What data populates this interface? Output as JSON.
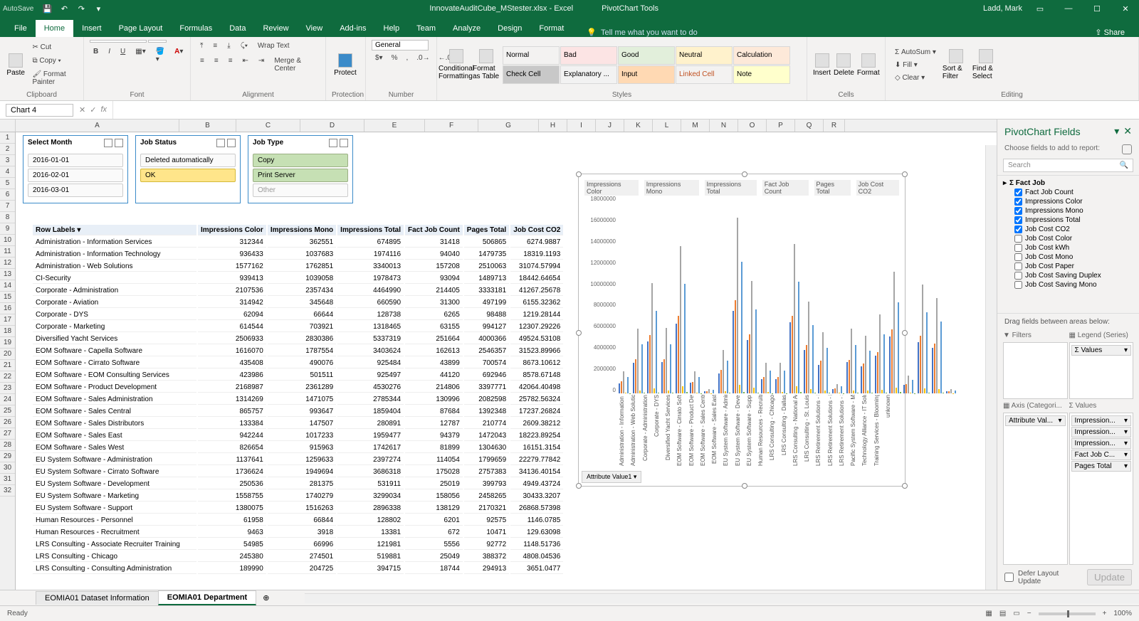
{
  "titlebar": {
    "autosave": "AutoSave",
    "filename": "InnovateAuditCube_MStester.xlsx - Excel",
    "tool_context": "PivotChart Tools",
    "user": "Ladd, Mark",
    "share": "Share"
  },
  "tabs": [
    "File",
    "Home",
    "Insert",
    "Page Layout",
    "Formulas",
    "Data",
    "Review",
    "View",
    "Add-ins",
    "Help",
    "Team",
    "Analyze",
    "Design",
    "Format"
  ],
  "active_tab": "Home",
  "tell_me": "Tell me what you want to do",
  "ribbon": {
    "clipboard": {
      "paste": "Paste",
      "cut": "Cut",
      "copy": "Copy",
      "fp": "Format Painter",
      "label": "Clipboard"
    },
    "font_label": "Font",
    "alignment": {
      "wrap": "Wrap Text",
      "merge": "Merge & Center",
      "label": "Alignment"
    },
    "protection": {
      "protect": "Protect",
      "label": "Protection"
    },
    "number": {
      "general": "General",
      "label": "Number"
    },
    "cond": "Conditional Formatting",
    "fat": "Format as Table",
    "styles_label": "Styles",
    "styles": [
      "Normal",
      "Bad",
      "Good",
      "Neutral",
      "Calculation",
      "Check Cell",
      "Explanatory ...",
      "Input",
      "Linked Cell",
      "Note"
    ],
    "cells": {
      "insert": "Insert",
      "delete": "Delete",
      "format": "Format",
      "label": "Cells"
    },
    "editing": {
      "autosum": "AutoSum",
      "fill": "Fill",
      "clear": "Clear",
      "sort": "Sort & Filter",
      "find": "Find & Select",
      "label": "Editing"
    }
  },
  "namebox": "Chart 4",
  "columns": [
    "A",
    "B",
    "C",
    "D",
    "E",
    "F",
    "G",
    "H",
    "I",
    "J",
    "K",
    "L",
    "M",
    "N",
    "O",
    "P",
    "Q",
    "R"
  ],
  "slicers": {
    "month": {
      "title": "Select Month",
      "items": [
        "2016-01-01",
        "2016-02-01",
        "2016-03-01"
      ]
    },
    "status": {
      "title": "Job Status",
      "items": [
        "Deleted automatically",
        "OK"
      ]
    },
    "type": {
      "title": "Job Type",
      "items": [
        "Copy",
        "Print Server",
        "Other"
      ]
    }
  },
  "headers_row": 2,
  "data_headers": [
    "Row Labels",
    "Impressions Color",
    "Impressions Mono",
    "Impressions Total",
    "Fact Job Count",
    "Pages Total",
    "Job Cost CO2"
  ],
  "rows": [
    [
      "Administration - Information Services",
      "312344",
      "362551",
      "674895",
      "31418",
      "506865",
      "6274.9887"
    ],
    [
      "Administration - Information Technology",
      "936433",
      "1037683",
      "1974116",
      "94040",
      "1479735",
      "18319.1193"
    ],
    [
      "Administration - Web Solutions",
      "1577162",
      "1762851",
      "3340013",
      "157208",
      "2510063",
      "31074.57994"
    ],
    [
      "CI-Security",
      "939413",
      "1039058",
      "1978473",
      "93094",
      "1489713",
      "18442.64654"
    ],
    [
      "Corporate - Administration",
      "2107536",
      "2357434",
      "4464990",
      "214405",
      "3333181",
      "41267.25678"
    ],
    [
      "Corporate - Aviation",
      "314942",
      "345648",
      "660590",
      "31300",
      "497199",
      "6155.32362"
    ],
    [
      "Corporate - DYS",
      "62094",
      "66644",
      "128738",
      "6265",
      "98488",
      "1219.28144"
    ],
    [
      "Corporate - Marketing",
      "614544",
      "703921",
      "1318465",
      "63155",
      "994127",
      "12307.29226"
    ],
    [
      "Diversified Yacht Services",
      "2506933",
      "2830386",
      "5337319",
      "251664",
      "4000366",
      "49524.53108"
    ],
    [
      "EOM Software - Capella Software",
      "1616070",
      "1787554",
      "3403624",
      "162613",
      "2546357",
      "31523.89966"
    ],
    [
      "EOM Software - Cirrato Software",
      "435408",
      "490076",
      "925484",
      "43899",
      "700574",
      "8673.10612"
    ],
    [
      "EOM Software - EOM Consulting Services",
      "423986",
      "501511",
      "925497",
      "44120",
      "692946",
      "8578.67148"
    ],
    [
      "EOM Software - Product Development",
      "2168987",
      "2361289",
      "4530276",
      "214806",
      "3397771",
      "42064.40498"
    ],
    [
      "EOM Software - Sales Administration",
      "1314269",
      "1471075",
      "2785344",
      "130996",
      "2082598",
      "25782.56324"
    ],
    [
      "EOM Software - Sales Central",
      "865757",
      "993647",
      "1859404",
      "87684",
      "1392348",
      "17237.26824"
    ],
    [
      "EOM Software - Sales Distributors",
      "133384",
      "147507",
      "280891",
      "12787",
      "210774",
      "2609.38212"
    ],
    [
      "EOM Software - Sales East",
      "942244",
      "1017233",
      "1959477",
      "94379",
      "1472043",
      "18223.89254"
    ],
    [
      "EOM Software - Sales West",
      "826654",
      "915963",
      "1742617",
      "81899",
      "1304630",
      "16151.3154"
    ],
    [
      "EU System Software - Administration",
      "1137641",
      "1259633",
      "2397274",
      "114054",
      "1799659",
      "22279.77842"
    ],
    [
      "EU System Software - Cirrato Software",
      "1736624",
      "1949694",
      "3686318",
      "175028",
      "2757383",
      "34136.40154"
    ],
    [
      "EU System Software - Development",
      "250536",
      "281375",
      "531911",
      "25019",
      "399793",
      "4949.43724"
    ],
    [
      "EU System Software - Marketing",
      "1558755",
      "1740279",
      "3299034",
      "158056",
      "2458265",
      "30433.3207"
    ],
    [
      "EU System Software - Support",
      "1380075",
      "1516263",
      "2896338",
      "138129",
      "2170321",
      "26868.57398"
    ],
    [
      "Human Resources - Personnel",
      "61958",
      "66844",
      "128802",
      "6201",
      "92575",
      "1146.0785"
    ],
    [
      "Human Resources - Recruitment",
      "9463",
      "3918",
      "13381",
      "672",
      "10471",
      "129.63098"
    ],
    [
      "LRS Consulting - Associate Recruiter Training",
      "54985",
      "66996",
      "121981",
      "5556",
      "92772",
      "1148.51736"
    ],
    [
      "LRS Consulting - Chicago",
      "245380",
      "274501",
      "519881",
      "25049",
      "388372",
      "4808.04536"
    ],
    [
      "LRS Consulting - Consulting Administration",
      "189990",
      "204725",
      "394715",
      "18744",
      "294913",
      "3651.0477"
    ]
  ],
  "chart": {
    "series_names": [
      "Impressions Color",
      "Impressions Mono",
      "Impressions Total",
      "Fact Job Count",
      "Pages Total",
      "Job Cost CO2"
    ],
    "yticks": [
      "18000000",
      "16000000",
      "14000000",
      "12000000",
      "10000000",
      "8000000",
      "6000000",
      "4000000",
      "2000000",
      "0"
    ],
    "attribute_btn": "Attribute Value1 ▾",
    "xlabels": [
      "Administration - Information Services",
      "Administration - Web Solutions",
      "Corporate - Administration",
      "Corporate - DYS",
      "Diversified Yacht Services",
      "EOM Software - Cirrato Software",
      "EOM Software - Product Development",
      "EOM Software - Sales Central",
      "EOM Software - Sales East",
      "EU System Software - Administration",
      "EU System Software - Development",
      "EU System Software - Support",
      "Human Resources - Recruitment",
      "LRS Consulting - Chicago",
      "LRS Consulting - Dallas",
      "LRS Consulting - National Accounts",
      "LRS Consulting - St. Louis",
      "LRS Retirement Solutions - Implementations",
      "LRS Retirement Solutions - Product Development",
      "LRS Retirement Solutions - Support",
      "Pacific System Software - Marketing",
      "Technology Alliance - IT Solutions",
      "Training Services - Bloomington Training Center",
      "unknown"
    ]
  },
  "chart_data": {
    "type": "bar",
    "title": "",
    "ylim": [
      0,
      18000000
    ],
    "series": [
      "Impressions Color",
      "Impressions Mono",
      "Impressions Total",
      "Fact Job Count",
      "Pages Total",
      "Job Cost CO2"
    ],
    "note": "multi-series clustered bar; full numeric values correspond to rows[] in this JSON"
  },
  "pivot": {
    "title": "PivotChart Fields",
    "choose": "Choose fields to add to report:",
    "search": "Search",
    "table": "Σ  Fact Job",
    "fields": [
      {
        "n": "Fact Job Count",
        "c": true
      },
      {
        "n": "Impressions Color",
        "c": true
      },
      {
        "n": "Impressions Mono",
        "c": true
      },
      {
        "n": "Impressions Total",
        "c": true
      },
      {
        "n": "Job Cost CO2",
        "c": true
      },
      {
        "n": "Job Cost Color",
        "c": false
      },
      {
        "n": "Job Cost kWh",
        "c": false
      },
      {
        "n": "Job Cost Mono",
        "c": false
      },
      {
        "n": "Job Cost Paper",
        "c": false
      },
      {
        "n": "Job Cost Saving Duplex",
        "c": false
      },
      {
        "n": "Job Cost Saving Mono",
        "c": false
      }
    ],
    "drag": "Drag fields between areas below:",
    "filters_hd": "▼ Filters",
    "legend_hd": "▦ Legend (Series)",
    "axis_hd": "▦ Axis (Categori...",
    "values_hd": "Σ Values",
    "legend_items": [
      "Σ Values"
    ],
    "axis_items": [
      "Attribute Val..."
    ],
    "values_items": [
      "Impression...",
      "Impression...",
      "Impression...",
      "Fact Job C...",
      "Pages Total"
    ],
    "defer": "Defer Layout Update",
    "update": "Update"
  },
  "sheet_tabs": [
    "EOMIA01 Dataset Information",
    "EOMIA01 Department"
  ],
  "active_sheet": 1,
  "status": {
    "ready": "Ready",
    "zoom": "100%"
  }
}
